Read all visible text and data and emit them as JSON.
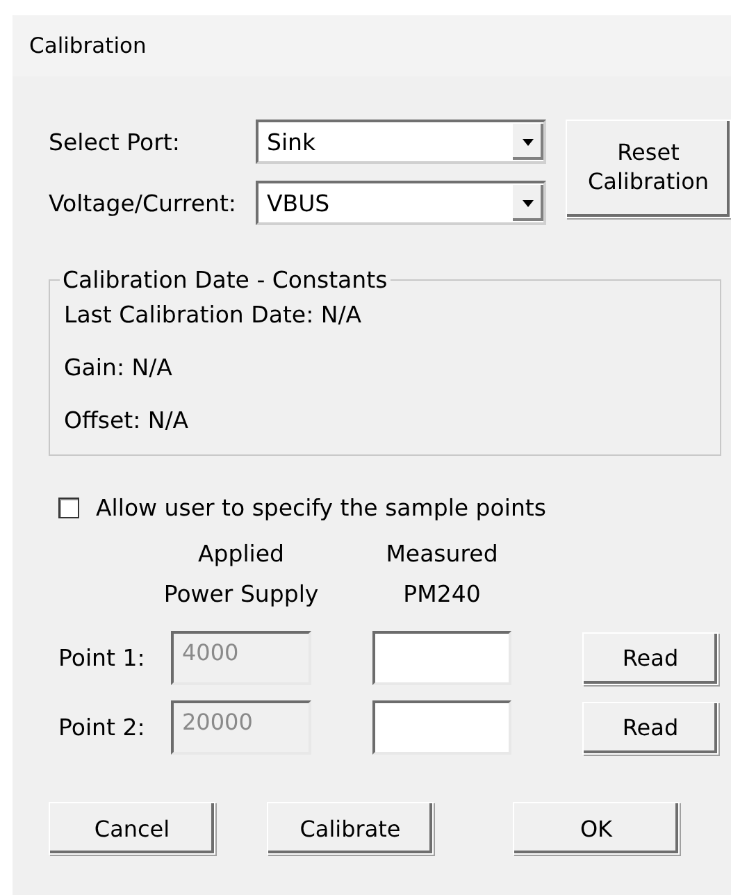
{
  "window": {
    "title": "Calibration"
  },
  "selectors": [
    {
      "label": "Select Port:",
      "value": "Sink"
    },
    {
      "label": "Voltage/Current:",
      "value": "VBUS"
    }
  ],
  "reset_button": "Reset Calibration",
  "constants": {
    "title": "Calibration Date - Constants",
    "lines": [
      "Last Calibration Date: N/A",
      "Gain: N/A",
      "Offset: N/A"
    ]
  },
  "allow_custom_points": {
    "label": "Allow user to specify the sample points",
    "checked": false
  },
  "columns": [
    {
      "lines": [
        "Applied",
        "Power Supply"
      ]
    },
    {
      "lines": [
        "Measured",
        "PM240"
      ]
    }
  ],
  "points": [
    {
      "label": "Point 1:",
      "applied": "4000",
      "disabled": true,
      "read_button": "Read"
    },
    {
      "label": "Point 2:",
      "applied": "20000",
      "disabled": true,
      "read_button": "Read"
    }
  ],
  "buttons": [
    "Cancel",
    "Calibrate",
    "OK"
  ]
}
